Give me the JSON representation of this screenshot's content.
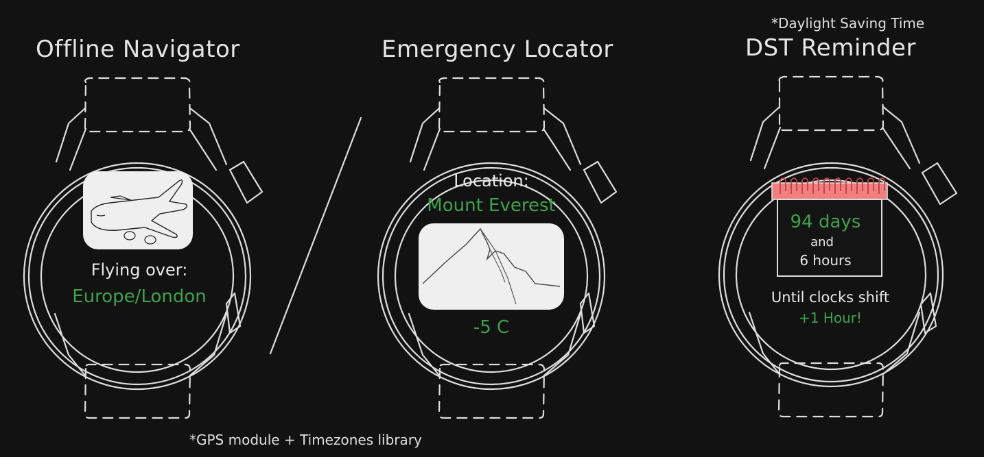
{
  "watches": [
    {
      "title": "Offline Navigator",
      "line1": "Flying over:",
      "line2": "Europe/London",
      "image": "airplane-sketch"
    },
    {
      "title": "Emergency Locator",
      "line1": "Location:",
      "line2": "Mount Everest",
      "line3": "-5 C",
      "image": "mountain-sketch"
    },
    {
      "title": "DST Reminder",
      "note": "*Daylight Saving Time",
      "calendar_days": "94 days",
      "calendar_and": "and",
      "calendar_hours": "6 hours",
      "line1": "Until clocks shift",
      "line2": "+1 Hour!",
      "image": "calendar-icon"
    }
  ],
  "footnote": "*GPS module + Timezones library",
  "colors": {
    "background": "#121212",
    "stroke": "#dedede",
    "highlight_green": "#3fa24b",
    "calendar_red": "#f08080"
  }
}
